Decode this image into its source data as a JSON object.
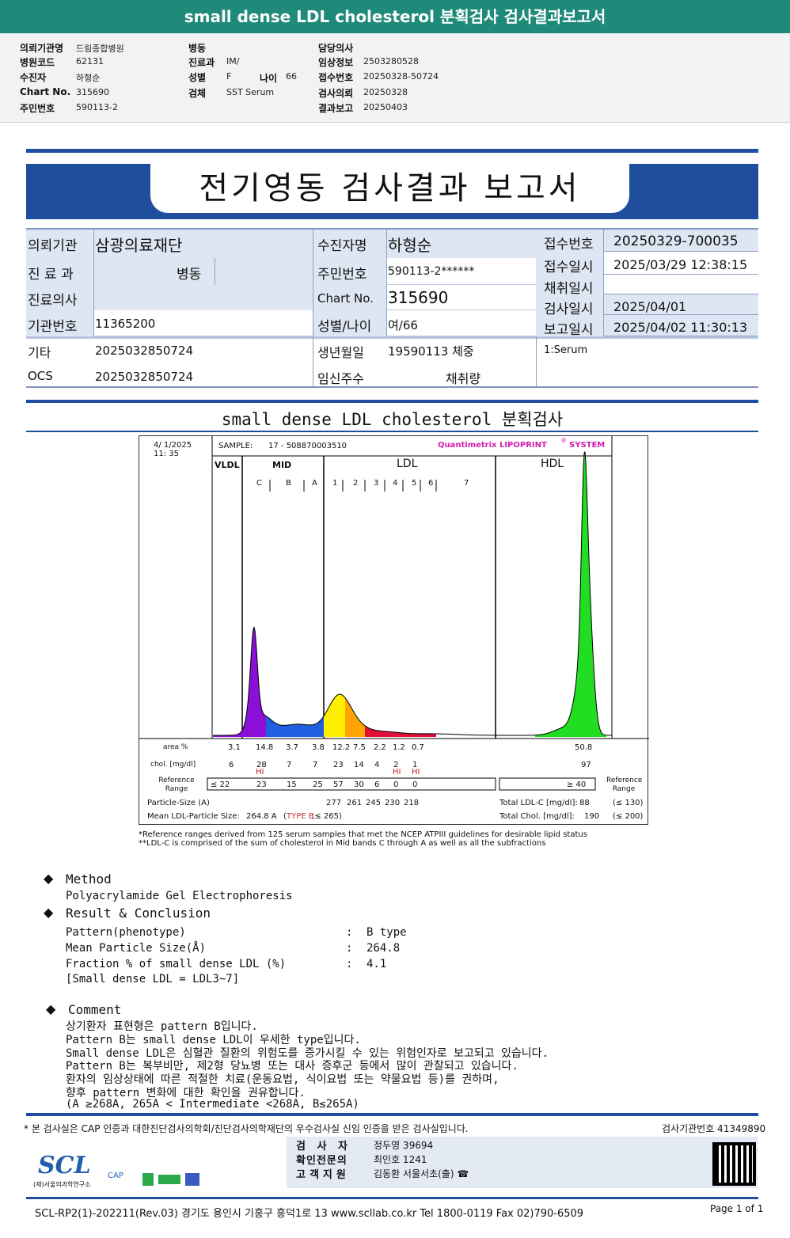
{
  "header": {
    "title": "small dense LDL cholesterol 분획검사 검사결과보고서"
  },
  "info": {
    "col1": [
      {
        "label": "의뢰기관명",
        "value": "드림종합병원"
      },
      {
        "label": "병원코드",
        "value": "62131"
      },
      {
        "label": "수진자",
        "value": "하형순"
      },
      {
        "label": "Chart No.",
        "value": "315690"
      },
      {
        "label": "주민번호",
        "value": "590113-2"
      }
    ],
    "col2": [
      {
        "label": "병동",
        "value": ""
      },
      {
        "label": "진료과",
        "value": "IM/"
      },
      {
        "label": "성별",
        "value": "F"
      },
      {
        "label": "검체",
        "value": "SST Serum"
      }
    ],
    "age_label": "나이",
    "age_value": "66",
    "col3": [
      {
        "label": "담당의사",
        "value": ""
      },
      {
        "label": "임상정보",
        "value": "2503280528"
      },
      {
        "label": "접수번호",
        "value": "20250328-50724"
      },
      {
        "label": "검사의뢰",
        "value": "20250328"
      },
      {
        "label": "결과보고",
        "value": "20250403"
      }
    ]
  },
  "report": {
    "title": "전기영동 검사결과 보고서",
    "rows": {
      "r1": [
        "의뢰기관",
        "삼광의료재단",
        "수진자명",
        "하형순",
        "접수번호",
        "20250329-700035"
      ],
      "r2": [
        "진 료 과",
        "병동",
        "주민번호",
        "590113-2******",
        "접수일시",
        "2025/03/29 12:38:15"
      ],
      "r3": [
        "진료의사",
        "",
        "Chart No.",
        "315690",
        "채취일시",
        ""
      ],
      "r4": [
        "기관번호",
        "11365200",
        "성별/나이",
        "여/66",
        "검사일시",
        "2025/04/01"
      ],
      "r5": [
        "기타",
        "2025032850724",
        "생년월일",
        "19590113 체중",
        "보고일시",
        "2025/04/02 11:30:13"
      ],
      "r6": [
        "OCS",
        "2025032850724",
        "임신주수",
        "채취량",
        "1:Serum"
      ]
    }
  },
  "section_title": "small dense LDL cholesterol 분획검사",
  "chart": {
    "date": "4/  1/2025",
    "time": "11: 35",
    "sample_label": "SAMPLE:",
    "sample": "17 - 508870003510",
    "brand": "Quantimetrix LIPOPRINT",
    "brand_mark": "®",
    "brand2": "SYSTEM",
    "groups": [
      "VLDL",
      "MID",
      "LDL",
      "HDL"
    ],
    "bands": [
      "C",
      "B",
      "A",
      "1",
      "2",
      "3",
      "4",
      "5",
      "6",
      "7"
    ],
    "row_labels": {
      "area": "area %",
      "chol": "chol. [mg/dl]",
      "ref": "Reference Range",
      "size": "Particle-Size (A)",
      "mean": "Mean LDL-Particle Size:"
    },
    "area": [
      "3.1",
      "14.8",
      "3.7",
      "3.8",
      "12.2",
      "7.5",
      "2.2",
      "1.2",
      "0.7"
    ],
    "area_hdl": "50.8",
    "chol": [
      "6",
      "28",
      "7",
      "7",
      "23",
      "14",
      "4",
      "2",
      "1"
    ],
    "chol_hdl": "97",
    "hi_flags": [
      "",
      "HI",
      "",
      "",
      "",
      "",
      "",
      "HI",
      "HI"
    ],
    "ref": [
      "≤ 22",
      "23",
      "15",
      "25",
      "57",
      "30",
      "6",
      "0",
      "0"
    ],
    "ref_hdl": "≥  40",
    "ref_right": "Reference Range",
    "size": [
      "277",
      "261",
      "245",
      "230",
      "218"
    ],
    "mean_value": "264.8 A",
    "mean_type": "TYPE B",
    "mean_tail": ";≤ 265)",
    "mean_open": "(",
    "total_ldl_label": "Total LDL-C [mg/dl]:",
    "total_ldl": "88",
    "total_ldl_ref": "(≤ 130)",
    "total_chol_label": "Total Chol. [mg/dl]:",
    "total_chol": "190",
    "total_chol_ref": "(≤ 200)",
    "colors": {
      "vldl": "#8a10d8",
      "mid": "#1f5fe0",
      "ldl1": "#ffee00",
      "ldl2": "#ffa500",
      "ldl3": "#e0103a",
      "hdl": "#22dd22"
    }
  },
  "notes": [
    "*Reference ranges derived from 125 serum samples that met the NCEP ATPIII guidelines for desirable lipid status",
    "**LDL-C is comprised of the sum of cholesterol in Mid bands C through A as well as all the subfractions"
  ],
  "method": {
    "title": "Method",
    "text": "Polyacrylamide Gel Electrophoresis"
  },
  "result": {
    "title": "Result & Conclusion",
    "rows": [
      [
        "Pattern(phenotype)",
        ":",
        "B type"
      ],
      [
        "Mean Particle Size(Å)",
        ":",
        "264.8"
      ],
      [
        "Fraction % of small dense LDL (%)",
        ":",
        "4.1"
      ]
    ],
    "extra": "[Small dense LDL = LDL3~7]"
  },
  "comment": {
    "title": "Comment",
    "lines": [
      "상기환자 표현형은 pattern B입니다.",
      "Pattern B는 small dense LDL이 우세한 type입니다.",
      "Small dense LDL은 심혈관 질환의 위험도를 증가시킬 수 있는 위험인자로 보고되고 있습니다.",
      "Pattern B는 복부비만, 제2형 당뇨병 또는 대사 증후군 등에서 많이 관찰되고 있습니다.",
      "환자의 임상상태에 따른 적절한 치료(운동요법, 식이요법 또는 약물요법 등)를 권하며,",
      "향후 pattern 변화에 대한 확인을 권유합니다.",
      "(A ≥268A, 265A < Intermediate <268A, B≤265A)"
    ]
  },
  "footer": {
    "cert": "* 본 검사실은 CAP 인증과 대한진단검사의학회/진단검사의학재단의 우수검사실 신임 인증을 받은 검사실입니다.",
    "lab_no": "검사기관번호 41349890",
    "staff": [
      [
        "검  사  자",
        "정두영 39694"
      ],
      [
        "확인전문의",
        "최인호 1241"
      ],
      [
        "고객지원",
        "김동환 서울서초(출) ☎"
      ]
    ],
    "logo": "SCL",
    "logo_sub": "(재)서울의과학연구소",
    "cert_logo": "CAP",
    "address": "SCL-RP2(1)-202211(Rev.03)  경기도 용인시 기흥구 흥덕1로 13  www.scllab.co.kr   Tel 1800-0119    Fax 02)790-6509",
    "page": "Page 1 of 1"
  }
}
